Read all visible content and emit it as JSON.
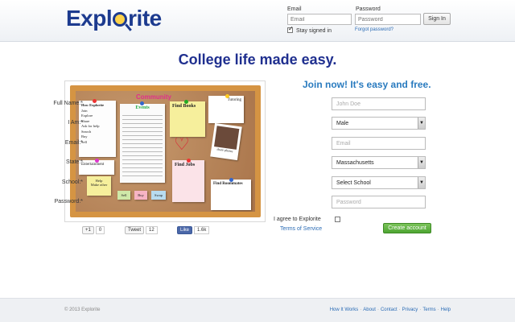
{
  "brand": {
    "logo_prefix": "Expl",
    "logo_suffix": "rite"
  },
  "login": {
    "email_label": "Email",
    "email_placeholder": "Email",
    "password_label": "Password",
    "password_placeholder": "Password",
    "signin_label": "Sign In",
    "stay_signed_in": "Stay signed in",
    "forgot": "Forgot password?"
  },
  "headline": "College life made easy.",
  "board": {
    "community": "Community",
    "how": "How Explorite",
    "how_items": [
      "Join",
      "Explore",
      "Share",
      "Ask for help",
      "Search",
      "Buy",
      "Sell"
    ],
    "events": "Events",
    "find_books": "Find Books",
    "tutoring": "Tutoring",
    "entertainment": "Entertainment",
    "find_jobs": "Find Jobs",
    "find_roommates": "Find Roommates",
    "help": "Help",
    "make_other": "Make other",
    "sell": "Sell",
    "buy": "Buy",
    "swap": "Swap",
    "share_photos": "share photos"
  },
  "social": {
    "gplus_label": "+1",
    "gplus_count": "0",
    "tweet_label": "Tweet",
    "tweet_count": "12",
    "like_label": "Like",
    "like_count": "1.6k"
  },
  "form": {
    "title": "Join now! It's easy and free.",
    "fullname_label": "Full Name:*",
    "fullname_placeholder": "John Doe",
    "iam_label": "I Am:*",
    "iam_value": "Male",
    "email_label": "Email:*",
    "email_placeholder": "Email",
    "state_label": "State:*",
    "state_value": "Massachusetts",
    "school_label": "School:*",
    "school_value": "Select School",
    "password_label": "Password:*",
    "password_placeholder": "Password",
    "agree_label": "I agree to Explorite",
    "terms_link": "Terms of Service",
    "create_label": "Create account"
  },
  "footer": {
    "copyright": "© 2013 Explorite",
    "links": [
      "How It Works",
      "About",
      "Contact",
      "Privacy",
      "Terms",
      "Help"
    ]
  },
  "colors": {
    "brand": "#1d3b8f",
    "accent": "#2a7bbf",
    "create": "#4ea532"
  }
}
